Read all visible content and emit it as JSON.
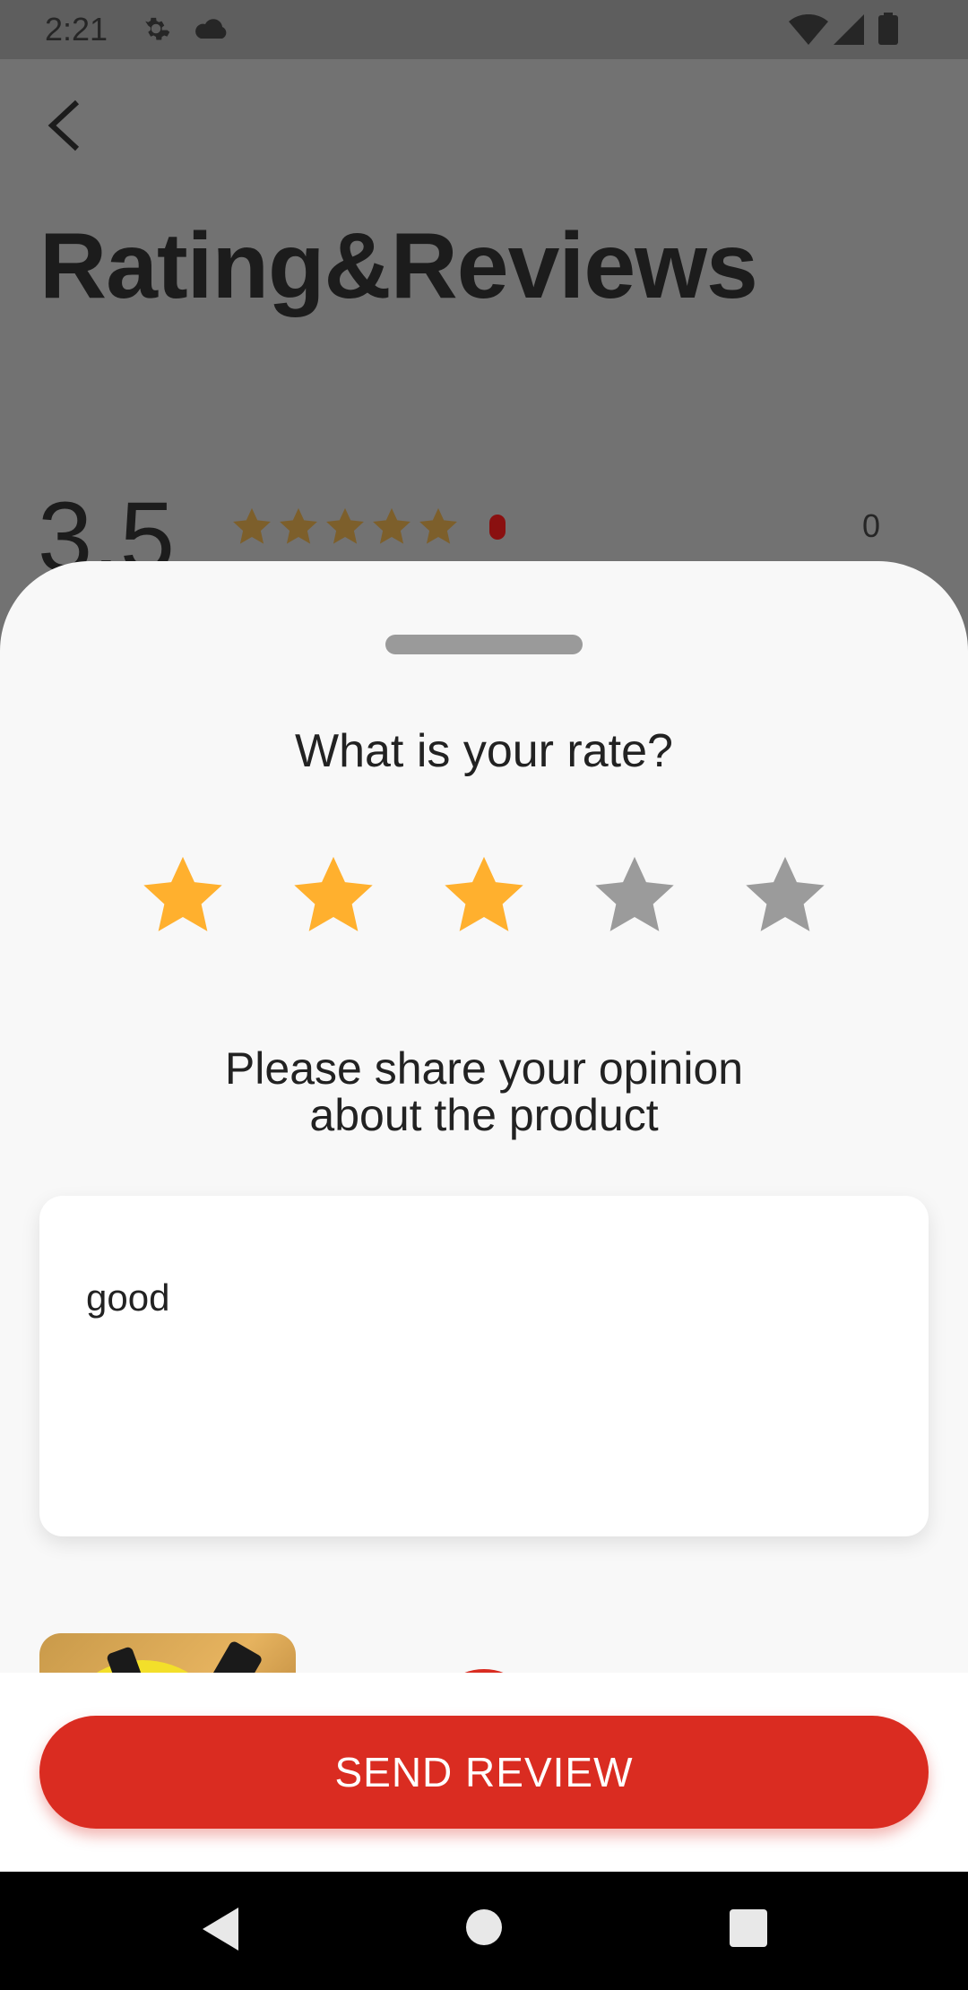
{
  "status_bar": {
    "time": "2:21",
    "icons": [
      "gear-icon",
      "cloud-icon",
      "wifi-icon",
      "signal-icon",
      "battery-icon"
    ]
  },
  "background_page": {
    "title": "Rating&Reviews",
    "average_rating": "3.5",
    "mini_stars": 5,
    "count_label": "0"
  },
  "sheet": {
    "rate_question": "What is your rate?",
    "selected_rating": 3,
    "max_rating": 5,
    "opinion_prompt_line1": "Please share your opinion",
    "opinion_prompt_line2": "about the product",
    "review_text": "good"
  },
  "footer": {
    "send_button_label": "SEND REVIEW"
  },
  "colors": {
    "star_active": "#FFB02E",
    "star_inactive": "#9B9B9B",
    "accent": "#DA2C21",
    "sheet_bg": "#F8F8F8"
  },
  "nav_bar": {
    "icons": [
      "back-icon",
      "home-icon",
      "recents-icon"
    ]
  }
}
